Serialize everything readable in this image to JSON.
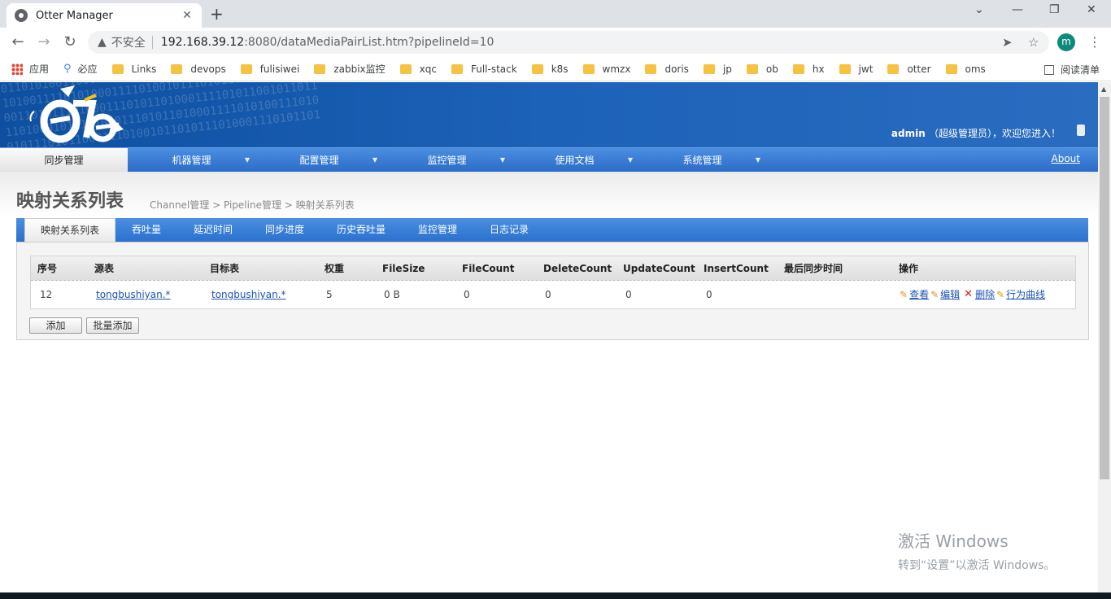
{
  "browser": {
    "tab_title": "Otter Manager",
    "tab_close": "✕",
    "new_tab": "+",
    "insecure_label": "不安全",
    "url_host": "192.168.39.12",
    "url_path": ":8080/dataMediaPairList.htm?pipelineId=10",
    "profile_initial": "m",
    "bookmarks": [
      "应用",
      "必应",
      "Links",
      "devops",
      "fulisiwei",
      "zabbix监控",
      "xqc",
      "Full-stack",
      "k8s",
      "wmzx",
      "doris",
      "jp",
      "ob",
      "hx",
      "jwt",
      "otter",
      "oms"
    ],
    "reading_list": "阅读清单"
  },
  "header": {
    "welcome_user": "admin",
    "welcome_role": "（超级管理员）",
    "welcome_suffix": "，欢迎您进入！"
  },
  "mainnav": {
    "items": [
      "同步管理",
      "机器管理",
      "配置管理",
      "监控管理",
      "使用文档",
      "系统管理"
    ],
    "about": "About"
  },
  "page": {
    "title": "映射关系列表",
    "breadcrumb": [
      "Channel管理",
      ">",
      "Pipeline管理",
      ">",
      "映射关系列表"
    ]
  },
  "subtabs": [
    "映射关系列表",
    "吞吐量",
    "延迟时间",
    "同步进度",
    "历史吞吐量",
    "监控管理",
    "日志记录"
  ],
  "table": {
    "columns": [
      "序号",
      "源表",
      "目标表",
      "权重",
      "FileSize",
      "FileCount",
      "DeleteCount",
      "UpdateCount",
      "InsertCount",
      "最后同步时间",
      "操作"
    ],
    "rows": [
      {
        "id": "12",
        "source": "tongbushiyan.*",
        "target": "tongbushiyan.*",
        "weight": "5",
        "file_size": "0 B",
        "file_count": "0",
        "delete_count": "0",
        "update_count": "0",
        "insert_count": "0",
        "last_sync": "",
        "actions": [
          "查看",
          "编辑",
          "删除",
          "行为曲线"
        ]
      }
    ]
  },
  "buttons": {
    "add": "添加",
    "batch_add": "批量添加"
  },
  "watermark": {
    "line1": "激活 Windows",
    "line2": "转到“设置”以激活 Windows。"
  },
  "colors": {
    "header_blue": "#1c62b8",
    "nav_blue": "#2b6cc8",
    "link": "#1c55b4",
    "delete_red": "#d42020"
  }
}
